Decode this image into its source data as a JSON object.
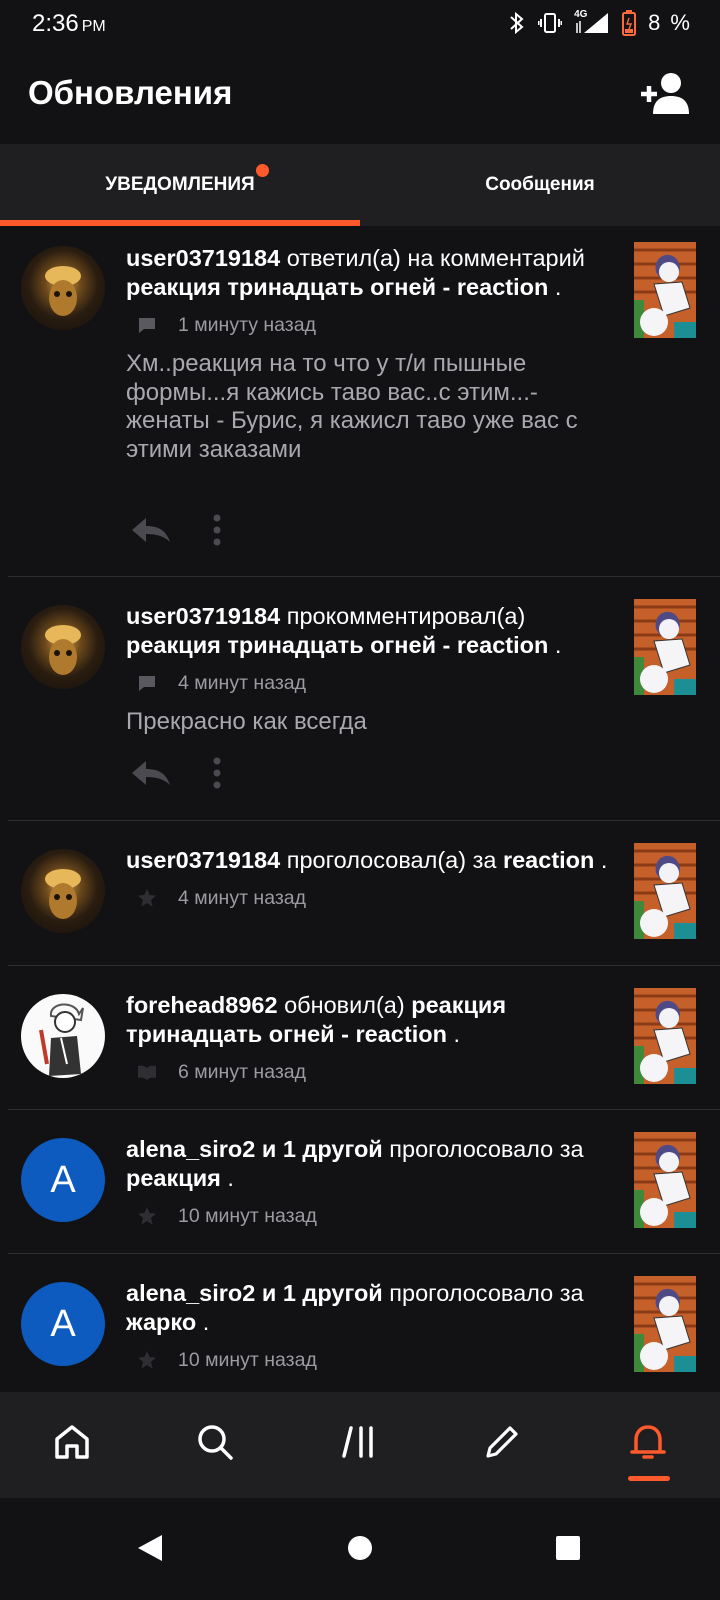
{
  "status_bar": {
    "time": "2:36",
    "ampm": "PM",
    "network": "4G",
    "battery": "8 %"
  },
  "header": {
    "title": "Обновления",
    "add_user_icon": "add-user-icon"
  },
  "tabs": [
    {
      "label": "УВЕДОМЛЕНИЯ",
      "active": true,
      "has_dot": true
    },
    {
      "label": "Сообщения",
      "active": false,
      "has_dot": false
    }
  ],
  "accent_color": "#ff5a2b",
  "notifications": [
    {
      "user": "user03719184",
      "action": "ответил(а) на комментарий",
      "target": "реакция тринадцать огней - reaction",
      "suffix": ".",
      "time": "1 минуту назад",
      "meta_icon": "comment-icon",
      "body": "Хм..реакция на то что у т/и пышные формы...я кажись таво вас..с этим...-женаты - Бурис, я кажисл таво уже вас с этими заказами"
    },
    {
      "user": "user03719184",
      "action": "прокомментировал(а)",
      "target": "реакция тринадцать огней - reaction",
      "suffix": ".",
      "time": "4 минут назад",
      "meta_icon": "comment-icon",
      "body": "Прекрасно как всегда"
    },
    {
      "user": "user03719184",
      "action": "проголосовал(а) за",
      "target": "reaction",
      "suffix": ".",
      "time": "4 минут назад",
      "meta_icon": "star-icon"
    },
    {
      "user": "forehead8962",
      "action": "обновил(а)",
      "target": "реакция тринадцать огней - reaction",
      "suffix": ".",
      "time": "6 минут назад",
      "meta_icon": "book-icon"
    },
    {
      "user": "alena_siro2 и 1 другой",
      "action": "проголосовало за",
      "target": "реакция",
      "suffix": ".",
      "time": "10 минут назад",
      "meta_icon": "star-icon",
      "avatar_letter": "A"
    },
    {
      "user": "alena_siro2 и 1 другой",
      "action": "проголосовало за",
      "target": "жарко",
      "suffix": ".",
      "time": "10 минут назад",
      "meta_icon": "star-icon",
      "avatar_letter": "A"
    }
  ],
  "bottom_nav": [
    {
      "icon": "home-icon"
    },
    {
      "icon": "search-icon"
    },
    {
      "icon": "library-icon"
    },
    {
      "icon": "pencil-icon"
    },
    {
      "icon": "bell-icon",
      "active": true
    }
  ],
  "system_nav": [
    "back-icon",
    "home-circle-icon",
    "recents-icon"
  ]
}
